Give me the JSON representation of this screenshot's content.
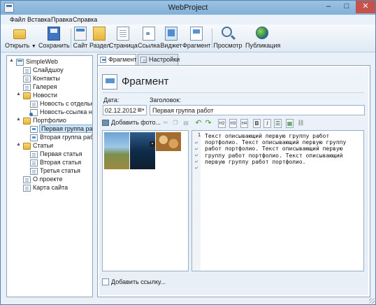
{
  "window": {
    "title": "WebProject"
  },
  "menu": [
    "Файл",
    "Вставка",
    "Правка",
    "Справка"
  ],
  "toolbar": [
    {
      "name": "open",
      "label": "Открыть",
      "icon": "folder-open-icon",
      "dropdown": true
    },
    {
      "name": "save",
      "label": "Сохранить",
      "icon": "disk-icon"
    },
    {
      "name": "site",
      "label": "Сайт",
      "icon": "site-icon"
    },
    {
      "name": "section",
      "label": "Раздел",
      "icon": "section-icon"
    },
    {
      "name": "page",
      "label": "Страница",
      "icon": "page-icon"
    },
    {
      "name": "link",
      "label": "Ссылка",
      "icon": "link-icon"
    },
    {
      "name": "widget",
      "label": "Виджет",
      "icon": "widget-icon"
    },
    {
      "name": "fragment",
      "label": "Фрагмент",
      "icon": "fragment-icon"
    },
    {
      "name": "preview",
      "label": "Просмотр",
      "icon": "magnifier-icon"
    },
    {
      "name": "publish",
      "label": "Публикация",
      "icon": "globe-icon"
    }
  ],
  "tree": [
    {
      "label": "SimpleWeb",
      "icon": "site",
      "expander": "▲"
    },
    {
      "label": "Слайдшоу",
      "icon": "page"
    },
    {
      "label": "Контакты",
      "icon": "page"
    },
    {
      "label": "Галерея",
      "icon": "page"
    },
    {
      "label": "Новости",
      "icon": "folder",
      "expander": "▲"
    },
    {
      "label": "Новость с отдельн",
      "icon": "page"
    },
    {
      "label": "Новость-ссылка на",
      "icon": "link"
    },
    {
      "label": "Портфолио",
      "icon": "folder",
      "expander": "▲"
    },
    {
      "label": "Первая группа раб",
      "icon": "frag",
      "selected": true
    },
    {
      "label": "Вторая группа раб",
      "icon": "frag"
    },
    {
      "label": "Статьи",
      "icon": "folder",
      "expander": "▲"
    },
    {
      "label": "Первая статья",
      "icon": "page"
    },
    {
      "label": "Вторая статья",
      "icon": "page"
    },
    {
      "label": "Третья статья",
      "icon": "page"
    },
    {
      "label": "О проекте",
      "icon": "page"
    },
    {
      "label": "Карта сайта",
      "icon": "page"
    }
  ],
  "tabs": [
    {
      "label": "Фрагмент",
      "active": true
    },
    {
      "label": "Настройки",
      "active": false
    }
  ],
  "editor": {
    "heading": "Фрагмент",
    "date_label": "Дата:",
    "date_value": "02.12.2012",
    "title_label": "Заголовок:",
    "title_value": "Первая группа работ",
    "add_photo_label": "Добавить фото...",
    "format_buttons": [
      "H2",
      "H3",
      "H4",
      "B",
      "I"
    ],
    "code_line_number": "1",
    "code_text": "Текст описывающий первую группу работ портфолио. Текст описывающий первую группу работ портфолио. Текст описывающий первую группу работ портфолио. Текст описывающий первую группу работ портфолио.",
    "add_link_label": "Добавить ссылку..."
  }
}
